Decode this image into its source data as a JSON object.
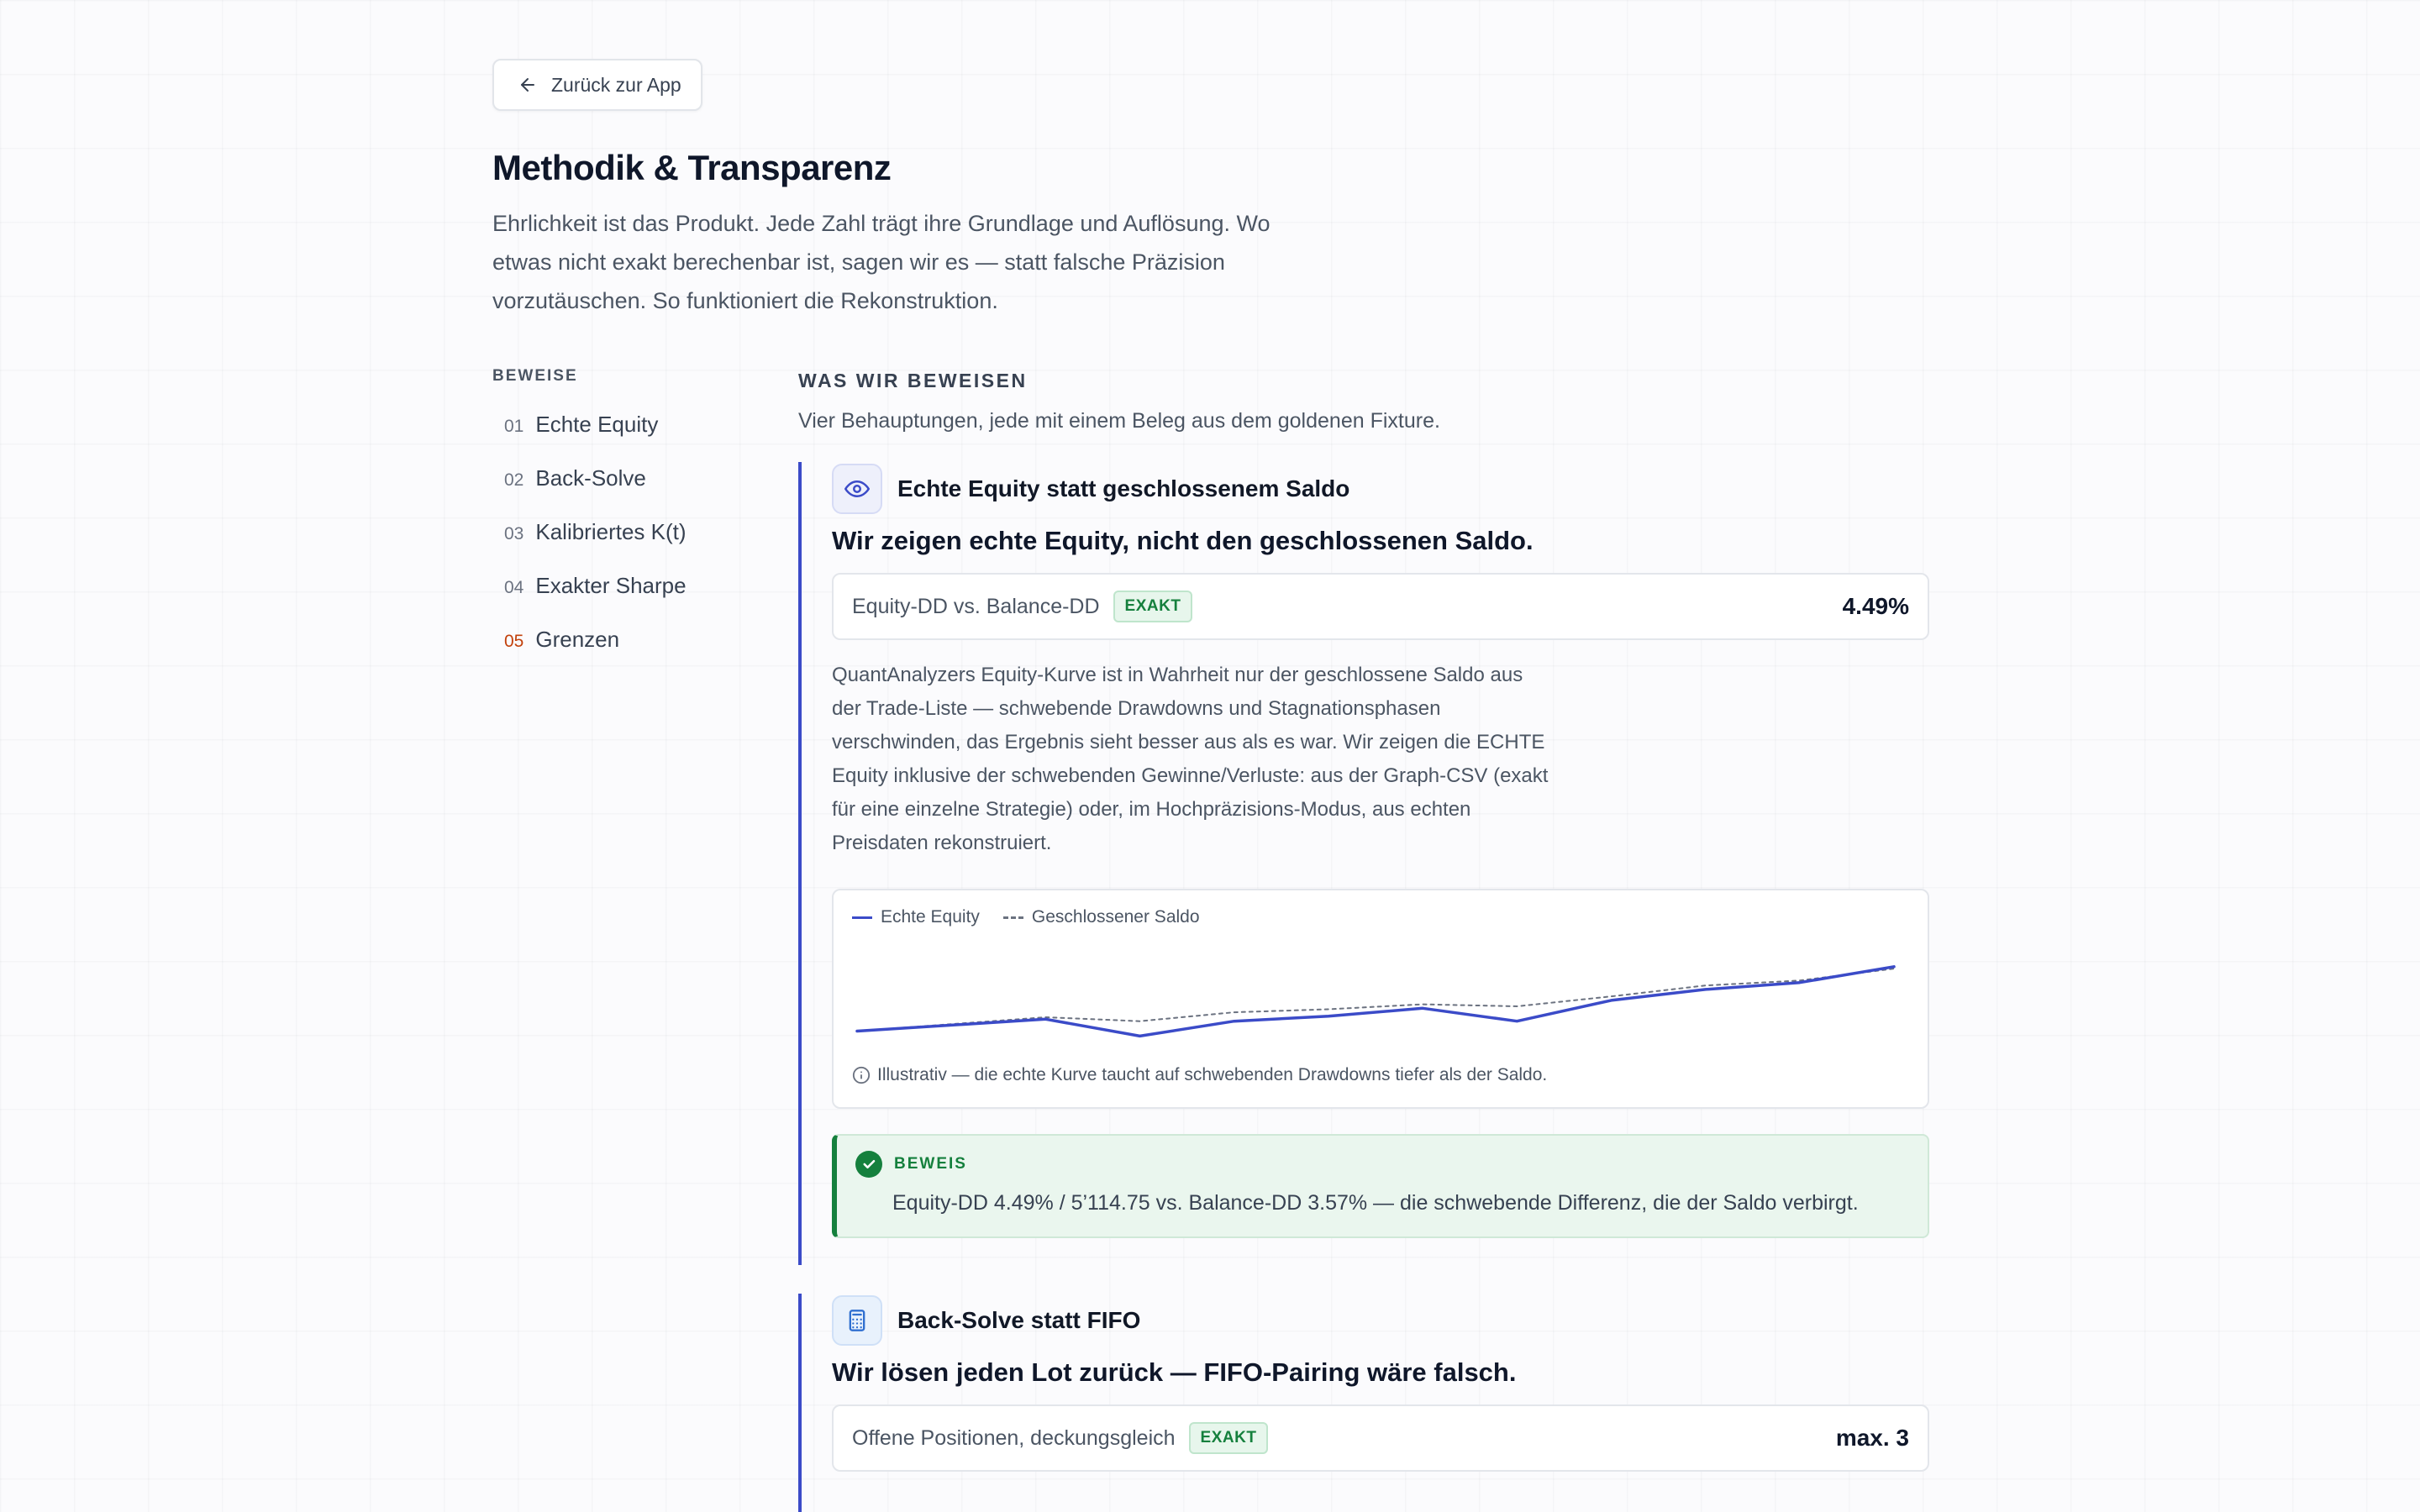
{
  "nav": {
    "back_label": "Zurück zur App"
  },
  "header": {
    "title": "Methodik & Transparenz",
    "intro": "Ehrlichkeit ist das Produkt. Jede Zahl trägt ihre Grundlage und Auflösung. Wo etwas nicht exakt berechenbar ist, sagen wir es — statt falsche Präzision vorzutäuschen. So funktioniert die Rekonstruktion."
  },
  "toc": {
    "heading": "BEWEISE",
    "items": [
      {
        "num": "01",
        "label": "Echte Equity"
      },
      {
        "num": "02",
        "label": "Back-Solve"
      },
      {
        "num": "03",
        "label": "Kalibriertes K(t)"
      },
      {
        "num": "04",
        "label": "Exakter Sharpe"
      },
      {
        "num": "05",
        "label": "Grenzen"
      }
    ]
  },
  "section": {
    "eyebrow": "WAS WIR BEWEISEN",
    "subtitle": "Vier Behauptungen, jede mit einem Beleg aus dem goldenen Fixture."
  },
  "claims": [
    {
      "icon": "eye-icon",
      "title": "Echte Equity statt geschlossenem Saldo",
      "statement": "Wir zeigen echte Equity, nicht den geschlossenen Saldo.",
      "metric_label": "Equity-DD vs. Balance-DD",
      "badge": "EXAKT",
      "metric_value": "4.49%",
      "body": "QuantAnalyzers Equity-Kurve ist in Wahrheit nur der geschlossene Saldo aus der Trade-Liste — schwebende Drawdowns und Stagnationsphasen verschwinden, das Ergebnis sieht besser aus als es war. Wir zeigen die ECHTE Equity inklusive der schwebenden Gewinne/Verluste: aus der Graph-CSV (exakt für eine einzelne Strategie) oder, im Hochpräzisions-Modus, aus echten Preisdaten rekonstruiert.",
      "proof_label": "BEWEIS",
      "proof_text": "Equity-DD 4.49% / 5’114.75 vs. Balance-DD 3.57% — die schwebende Differenz, die der Saldo verbirgt."
    },
    {
      "icon": "calculator-icon",
      "title": "Back-Solve statt FIFO",
      "statement": "Wir lösen jeden Lot zurück — FIFO-Pairing wäre falsch.",
      "metric_label": "Offene Positionen, deckungsgleich",
      "badge": "EXAKT",
      "metric_value": "max. 3"
    }
  ],
  "chart_data": {
    "type": "line",
    "legend": [
      "Echte Equity",
      "Geschlossener Saldo"
    ],
    "note": "Illustrativ — die echte Kurve taucht auf schwebenden Drawdowns tiefer als der Saldo.",
    "x": [
      0,
      1,
      2,
      3,
      4,
      5,
      6,
      7,
      8,
      9,
      10,
      11
    ],
    "series": [
      {
        "name": "Echte Equity",
        "values": [
          14,
          20,
          26,
          9,
          24,
          29,
          37,
          24,
          45,
          56,
          63,
          79
        ]
      },
      {
        "name": "Geschlossener Saldo",
        "values": [
          14,
          21,
          28,
          24,
          33,
          36,
          41,
          39,
          49,
          60,
          65,
          77
        ]
      }
    ],
    "ylim": [
      0,
      100
    ],
    "colors": {
      "equity": "#3b4bc8",
      "saldo": "#6b7280"
    }
  }
}
